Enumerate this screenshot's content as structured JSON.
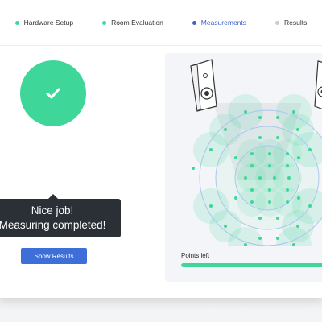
{
  "stepper": {
    "steps": [
      {
        "label": "Hardware Setup",
        "state": "done"
      },
      {
        "label": "Room Evaluation",
        "state": "done"
      },
      {
        "label": "Measurements",
        "state": "active"
      },
      {
        "label": "Results",
        "state": "pending"
      }
    ]
  },
  "status": {
    "icon": "check-icon",
    "message_line1": "Nice job!",
    "message_line2": "Measuring completed!"
  },
  "actions": {
    "show_results_label": "Show Results"
  },
  "measurement_panel": {
    "points_left_label": "Points left",
    "points_progress_fraction": 1.0
  },
  "colors": {
    "accent_green": "#3fd69a",
    "accent_blue": "#3e6fd8",
    "active_text": "#3e5fc9",
    "pending_dot": "#c7cbd1"
  }
}
